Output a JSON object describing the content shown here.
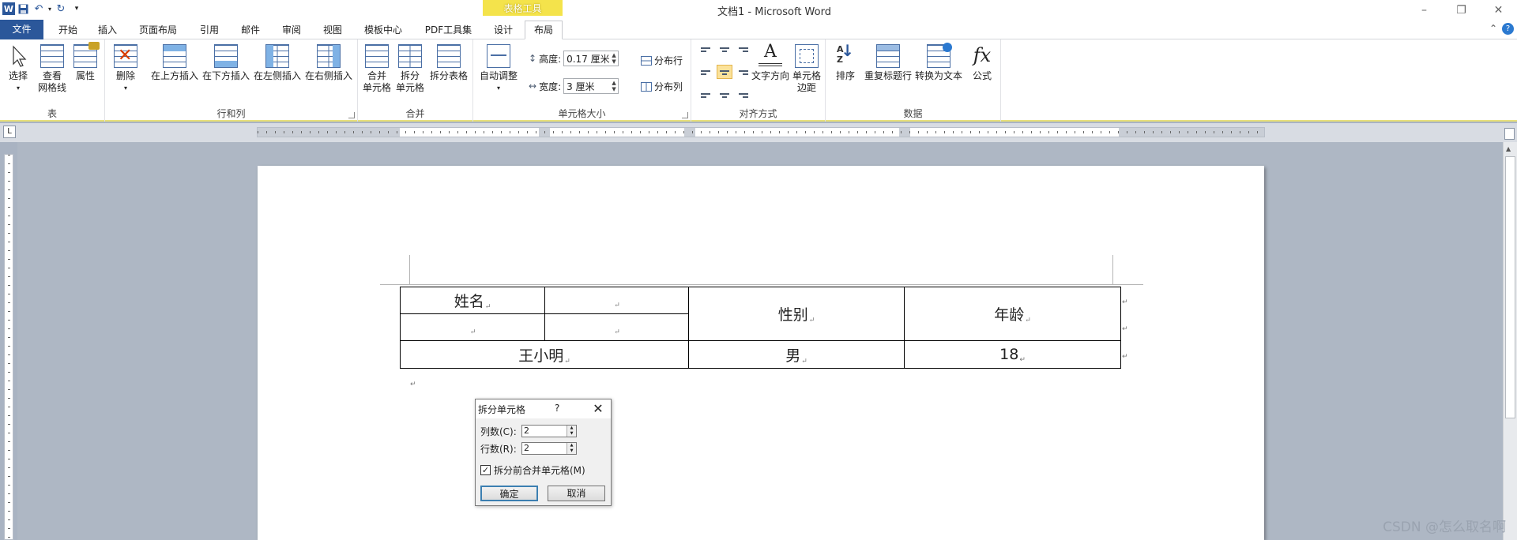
{
  "window": {
    "title": "文档1 - Microsoft Word",
    "context_tab": "表格工具"
  },
  "tabs": [
    "文件",
    "开始",
    "插入",
    "页面布局",
    "引用",
    "邮件",
    "审阅",
    "视图",
    "模板中心",
    "PDF工具集",
    "设计",
    "布局"
  ],
  "ribbon": {
    "groups": {
      "table": "表",
      "rows_cols": "行和列",
      "merge": "合并",
      "cell_size": "单元格大小",
      "alignment": "对齐方式",
      "data": "数据"
    },
    "table": {
      "select": "选择",
      "gridlines_1": "查看",
      "gridlines_2": "网格线",
      "properties": "属性"
    },
    "rows_cols": {
      "delete": "删除",
      "insert_above": "在上方插入",
      "insert_below": "在下方插入",
      "insert_left": "在左侧插入",
      "insert_right": "在右侧插入"
    },
    "merge": {
      "merge_1": "合并",
      "merge_2": "单元格",
      "split_1": "拆分",
      "split_2": "单元格",
      "split_table": "拆分表格"
    },
    "cell_size": {
      "autofit": "自动调整",
      "height_label": "高度:",
      "height_value": "0.17 厘米",
      "width_label": "宽度:",
      "width_value": "3 厘米",
      "dist_rows": "分布行",
      "dist_cols": "分布列"
    },
    "alignment": {
      "text_direction": "文字方向",
      "margins_1": "单元格",
      "margins_2": "边距"
    },
    "data": {
      "sort": "排序",
      "repeat_header": "重复标题行",
      "convert_text": "转换为文本",
      "formula": "公式"
    }
  },
  "document": {
    "table": {
      "name": "姓名",
      "gender": "性别",
      "age": "年龄",
      "person_name": "王小明",
      "person_gender": "男",
      "person_age": "18"
    }
  },
  "dialog": {
    "title": "拆分单元格",
    "help": "?",
    "cols_label": "列数(C):",
    "cols_value": "2",
    "rows_label": "行数(R):",
    "rows_value": "2",
    "merge_label": "拆分前合并单元格(M)",
    "merge_checked": true,
    "ok": "确定",
    "cancel": "取消"
  },
  "watermark": "CSDN @怎么取名啊",
  "colors": {
    "file_tab": "#2b579a",
    "context_tab": "#f4e34b",
    "page_bg": "#aeb7c4"
  }
}
